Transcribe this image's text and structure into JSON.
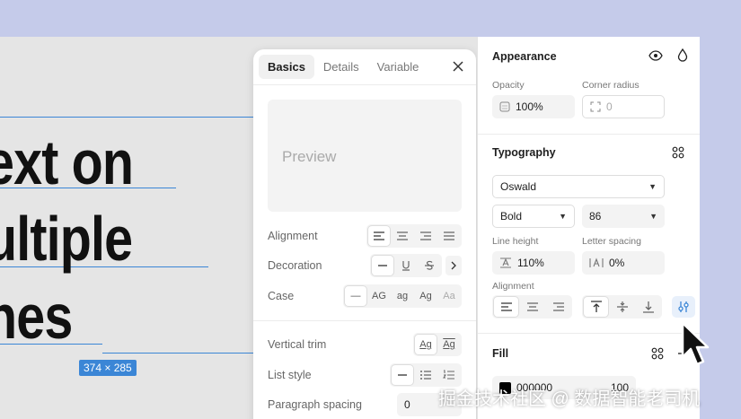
{
  "canvas": {
    "lines": [
      "ext on",
      "ultiple",
      "nes"
    ],
    "size_badge": "374 × 285"
  },
  "popover": {
    "tabs": [
      {
        "label": "Basics",
        "active": true
      },
      {
        "label": "Details",
        "active": false
      },
      {
        "label": "Variable",
        "active": false
      }
    ],
    "preview_text": "Preview",
    "alignment_label": "Alignment",
    "decoration_label": "Decoration",
    "case_label": "Case",
    "case_options": [
      "—",
      "AG",
      "ag",
      "Ag",
      "Aa"
    ],
    "vertical_trim_label": "Vertical trim",
    "vertical_trim_options": [
      "Ag",
      "Ag"
    ],
    "list_style_label": "List style",
    "paragraph_spacing_label": "Paragraph spacing",
    "paragraph_spacing_value": "0"
  },
  "panel": {
    "appearance": {
      "title": "Appearance",
      "opacity_label": "Opacity",
      "opacity_value": "100%",
      "radius_label": "Corner radius",
      "radius_value": "0"
    },
    "typography": {
      "title": "Typography",
      "font_family": "Oswald",
      "font_weight": "Bold",
      "font_size": "86",
      "line_height_label": "Line height",
      "line_height_value": "110%",
      "letter_spacing_label": "Letter spacing",
      "letter_spacing_value": "0%",
      "alignment_label": "Alignment"
    },
    "fill": {
      "title": "Fill",
      "hex_value": "000000",
      "opacity_value": "100"
    }
  },
  "watermark": "掘金技术社区 @ 数据智能老司机",
  "colors": {
    "accent": "#3b86d6",
    "background": "#c5cbea",
    "canvas": "#e5e5e5"
  }
}
